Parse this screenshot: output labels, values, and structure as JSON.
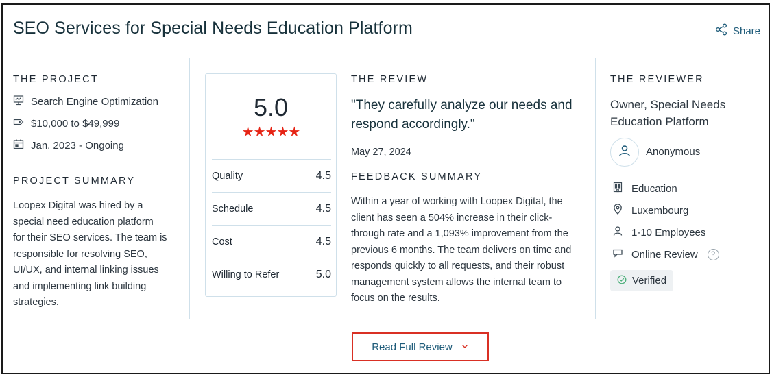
{
  "header": {
    "title": "SEO Services for Special Needs Education Platform",
    "share_label": "Share"
  },
  "project": {
    "section_title": "THE PROJECT",
    "service": "Search Engine Optimization",
    "budget": "$10,000 to $49,999",
    "timeline": "Jan. 2023 - Ongoing",
    "summary_title": "PROJECT SUMMARY",
    "summary_lines": [
      "Loopex Digital was hired by a",
      "special need education platform",
      "for their SEO services. The team is",
      "responsible for resolving SEO,",
      "UI/UX, and internal linking issues",
      "and implementing link building",
      "strategies."
    ]
  },
  "rating": {
    "overall": "5.0",
    "stars": "★★★★★",
    "scores": [
      {
        "label": "Quality",
        "value": "4.5"
      },
      {
        "label": "Schedule",
        "value": "4.5"
      },
      {
        "label": "Cost",
        "value": "4.5"
      },
      {
        "label": "Willing to Refer",
        "value": "5.0"
      }
    ]
  },
  "review": {
    "section_title": "THE REVIEW",
    "quote_lines": [
      "\"They carefully analyze our needs and",
      "respond accordingly.\""
    ],
    "date": "May 27, 2024",
    "feedback_title": "FEEDBACK SUMMARY",
    "feedback_lines": [
      "Within a year of working with Loopex Digital, the",
      "client has seen a 504% increase in their click-",
      "through rate and a 1,093% improvement from the",
      "previous 6 months. The team delivers on time and",
      "responds quickly to all requests,  and their robust",
      "management system allows the internal team to",
      "focus on the results."
    ]
  },
  "reviewer": {
    "section_title": "THE REVIEWER",
    "role_lines": [
      "Owner, Special Needs",
      "Education Platform"
    ],
    "name": "Anonymous",
    "industry": "Education",
    "location": "Luxembourg",
    "size": "1-10 Employees",
    "review_type": "Online Review",
    "help_glyph": "?",
    "verified": "Verified"
  },
  "cta": {
    "read_full_review": "Read Full Review"
  },
  "colors": {
    "accent_red": "#e62415",
    "link_blue": "#1f5c7a",
    "divider": "#cfe0ea"
  }
}
